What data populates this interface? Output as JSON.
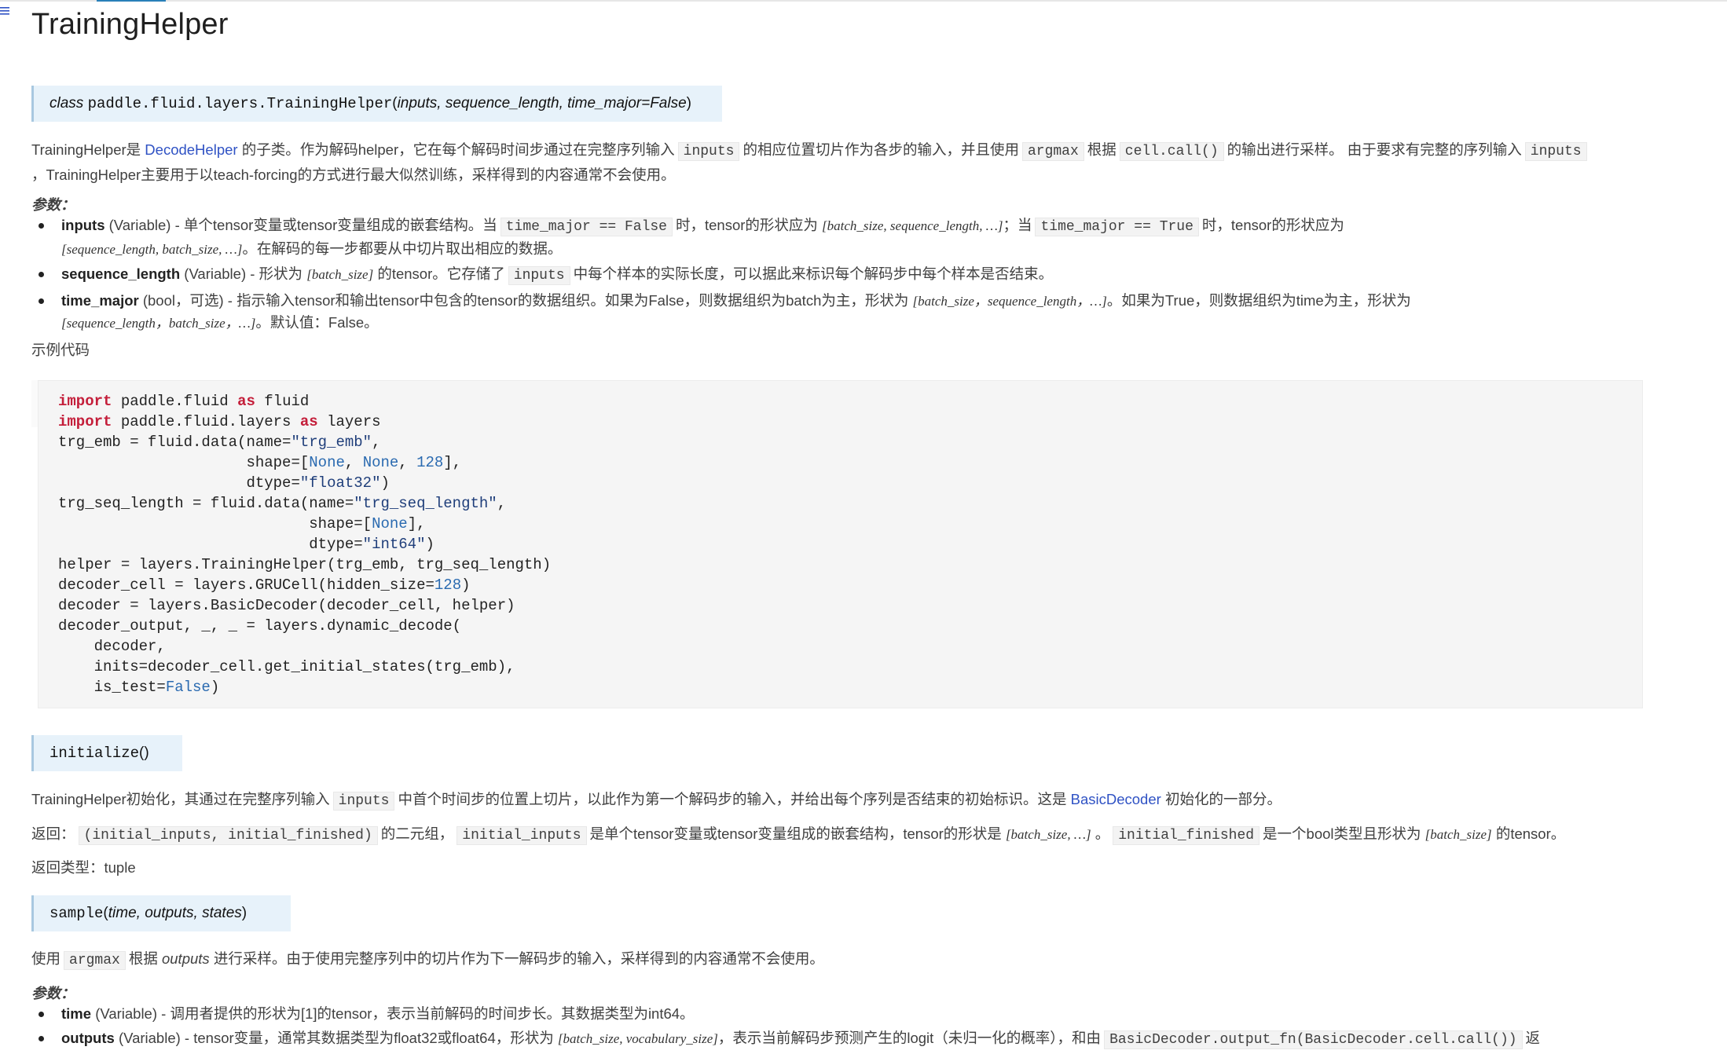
{
  "page": {
    "title": "TrainingHelper"
  },
  "class_sig": {
    "prefix": "class",
    "name": "paddle.fluid.layers.TrainingHelper",
    "params": "inputs, sequence_length, time_major=False"
  },
  "intro": {
    "t1": "TrainingHelper是",
    "link": "DecodeHelper",
    "t2": "的子类。作为解码helper，它在每个解码时间步通过在完整序列输入",
    "c1": "inputs",
    "t3": "的相应位置切片作为各步的输入，并且使用",
    "c2": "argmax",
    "t4": "根据",
    "c3": "cell.call()",
    "t5": "的输出进行采样。 由于要求有完整的序列输入",
    "c4": "inputs",
    "line2": "，TrainingHelper主要用于以teach-forcing的方式进行最大似然训练，采样得到的内容通常不会使用。"
  },
  "params1": {
    "title": "参数：",
    "p1": {
      "name": "inputs",
      "type": "(Variable)",
      "t1": " - 单个tensor变量或tensor变量组成的嵌套结构。当",
      "c1": "time_major == False",
      "t2": "时，tensor的形状应为",
      "m1": "[batch_size, sequence_length, …]",
      "t3": "；当",
      "c2": "time_major == True",
      "t4": "时，tensor的形状应为",
      "m2": "[sequence_length, batch_size, …]",
      "t5": "。在解码的每一步都要从中切片取出相应的数据。"
    },
    "p2": {
      "name": "sequence_length",
      "type": "(Variable)",
      "t1": " - 形状为",
      "m1": "[batch_size]",
      "t2": "的tensor。它存储了",
      "c1": "inputs",
      "t3": "中每个样本的实际长度，可以据此来标识每个解码步中每个样本是否结束。"
    },
    "p3": {
      "name": "time_major",
      "type": "(bool，可选)",
      "t1": " - 指示输入tensor和输出tensor中包含的tensor的数据组织。如果为False，则数据组织为batch为主，形状为",
      "m1": "[batch_size，sequence_length，…]",
      "t2": "。如果为True，则数据组织为time为主，形状为",
      "m2": "[sequence_length，batch_size，…]",
      "t3": "。默认值：False。"
    }
  },
  "example": {
    "title": "示例代码",
    "lines": {
      "l1_kw": "import",
      "l1_a": " paddle.fluid ",
      "l1_kw2": "as",
      "l1_b": " fluid",
      "l2_kw": "import",
      "l2_a": " paddle.fluid.layers ",
      "l2_kw2": "as",
      "l2_b": " layers",
      "l3_a": "trg_emb = fluid.data(name=",
      "l3_s": "\"trg_emb\"",
      "l3_b": ",",
      "l4_a": "                     shape=[",
      "l4_n1": "None",
      "l4_b": ", ",
      "l4_n2": "None",
      "l4_c": ", ",
      "l4_n3": "128",
      "l4_d": "],",
      "l5_a": "                     dtype=",
      "l5_s": "\"float32\"",
      "l5_b": ")",
      "l6_a": "trg_seq_length = fluid.data(name=",
      "l6_s": "\"trg_seq_length\"",
      "l6_b": ",",
      "l7_a": "                            shape=[",
      "l7_n1": "None",
      "l7_b": "],",
      "l8_a": "                            dtype=",
      "l8_s": "\"int64\"",
      "l8_b": ")",
      "l9": "helper = layers.TrainingHelper(trg_emb, trg_seq_length)",
      "l10_a": "decoder_cell = layers.GRUCell(hidden_size=",
      "l10_n": "128",
      "l10_b": ")",
      "l11": "decoder = layers.BasicDecoder(decoder_cell, helper)",
      "l12": "decoder_output, _, _ = layers.dynamic_decode(",
      "l13": "    decoder,",
      "l14": "    inits=decoder_cell.get_initial_states(trg_emb),",
      "l15_a": "    is_test=",
      "l15_b": "False",
      "l15_c": ")"
    }
  },
  "initialize": {
    "sig_name": "initialize",
    "sig_paren": "()",
    "desc_t1": "TrainingHelper初始化，其通过在完整序列输入",
    "desc_c1": "inputs",
    "desc_t2": "中首个时间步的位置上切片，以此作为第一个解码步的输入，并给出每个序列是否结束的初始标识。这是",
    "desc_link": "BasicDecoder",
    "desc_t3": "初始化的一部分。",
    "ret_t1": "返回：",
    "ret_c1": "(initial_inputs, initial_finished)",
    "ret_t2": "的二元组，",
    "ret_c2": "initial_inputs",
    "ret_t3": "是单个tensor变量或tensor变量组成的嵌套结构，tensor的形状是",
    "ret_m1": "[batch_size, …]",
    "ret_t4": "。",
    "ret_c3": "initial_finished",
    "ret_t5": "是一个bool类型且形状为",
    "ret_m2": "[batch_size]",
    "ret_t6": "的tensor。",
    "rtype": "返回类型：tuple"
  },
  "sample": {
    "sig_name": "sample",
    "sig_params": "time, outputs, states",
    "desc_t1": "使用",
    "desc_c1": "argmax",
    "desc_t2": "根据",
    "desc_em": "outputs",
    "desc_t3": "进行采样。由于使用完整序列中的切片作为下一解码步的输入，采样得到的内容通常不会使用。",
    "params_title": "参数：",
    "p1_name": "time",
    "p1_type": "(Variable)",
    "p1_desc": " - 调用者提供的形状为[1]的tensor，表示当前解码的时间步长。其数据类型为int64。",
    "p2_name": "outputs",
    "p2_type": "(Variable)",
    "p2_t1": " - tensor变量，通常其数据类型为float32或float64，形状为",
    "p2_m1": "[batch_size, vocabulary_size]",
    "p2_t2": "，表示当前解码步预测产生的logit（未归一化的概率），和由",
    "p2_c1": "BasicDecoder.output_fn(BasicDecoder.cell.call())",
    "p2_t3": "返"
  }
}
